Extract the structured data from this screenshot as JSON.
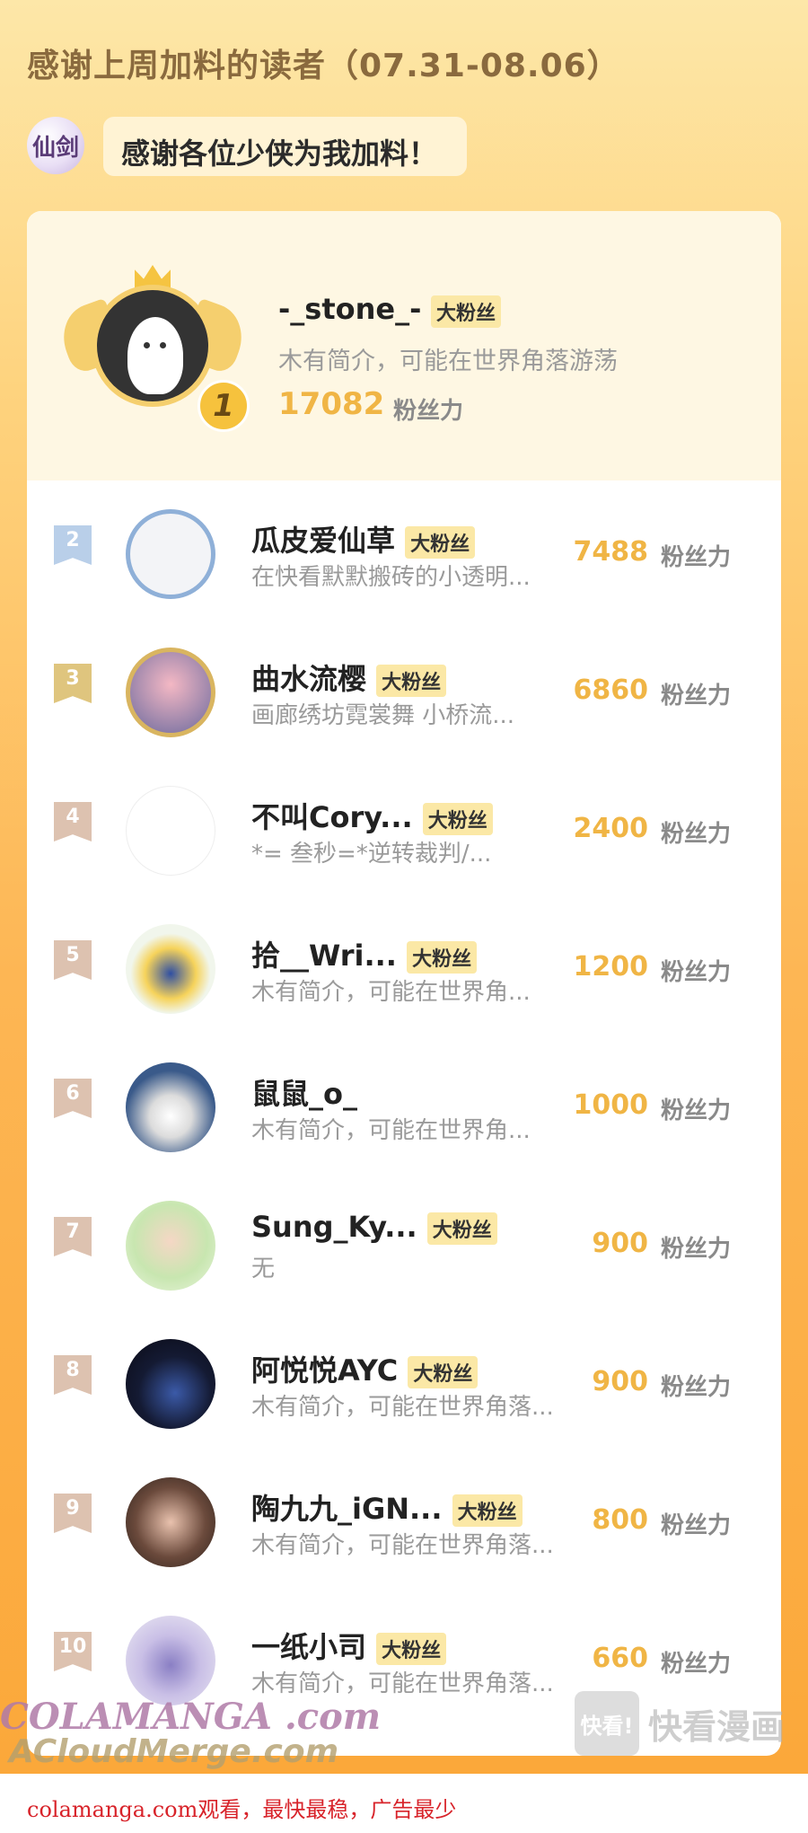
{
  "header": {
    "title": "感谢上周加料的读者（07.31-08.06）"
  },
  "logo": {
    "text": "仙剑"
  },
  "greeting": "感谢各位少侠为我加料！",
  "top_fan": {
    "rank": "1",
    "name": "-_stone_-",
    "badge": "大粉丝",
    "desc": "木有简介，可能在世界角落游荡",
    "points": "17082",
    "unit": "粉丝力"
  },
  "fans": [
    {
      "rank": "2",
      "name": "瓜皮爱仙草",
      "badge": "大粉丝",
      "desc": "在快看默默搬砖的小透明...",
      "points": "7488",
      "unit": "粉丝力"
    },
    {
      "rank": "3",
      "name": "曲水流樱",
      "badge": "大粉丝",
      "desc": "画廊绣坊霓裳舞 小桥流...",
      "points": "6860",
      "unit": "粉丝力"
    },
    {
      "rank": "4",
      "name": "不叫Cory...",
      "badge": "大粉丝",
      "desc": "*= 叁秒=*逆转裁判/...",
      "points": "2400",
      "unit": "粉丝力"
    },
    {
      "rank": "5",
      "name": "拾__Wri...",
      "badge": "大粉丝",
      "desc": "木有简介，可能在世界角...",
      "points": "1200",
      "unit": "粉丝力"
    },
    {
      "rank": "6",
      "name": "鼠鼠_o_",
      "badge": "",
      "desc": "木有简介，可能在世界角...",
      "points": "1000",
      "unit": "粉丝力"
    },
    {
      "rank": "7",
      "name": "Sung_Ky...",
      "badge": "大粉丝",
      "desc": "无",
      "points": "900",
      "unit": "粉丝力"
    },
    {
      "rank": "8",
      "name": "阿悦悦AYC",
      "badge": "大粉丝",
      "desc": "木有简介，可能在世界角落...",
      "points": "900",
      "unit": "粉丝力"
    },
    {
      "rank": "9",
      "name": "陶九九_iGN...",
      "badge": "大粉丝",
      "desc": "木有简介，可能在世界角落...",
      "points": "800",
      "unit": "粉丝力"
    },
    {
      "rank": "10",
      "name": "一纸小司",
      "badge": "大粉丝",
      "desc": "木有简介，可能在世界角落...",
      "points": "660",
      "unit": "粉丝力"
    }
  ],
  "watermarks": {
    "colamanga": "COLAMANGA .com",
    "acloud": "ACloudMerge.com",
    "kuaikan_box": "快看!",
    "kuaikan_text": "快看漫画"
  },
  "footer": "colamanga.com观看，最快最稳，广告最少",
  "colors": {
    "accent": "#f0b545",
    "badge_bg": "#fbe8a6",
    "footer_red": "#d8232a"
  }
}
